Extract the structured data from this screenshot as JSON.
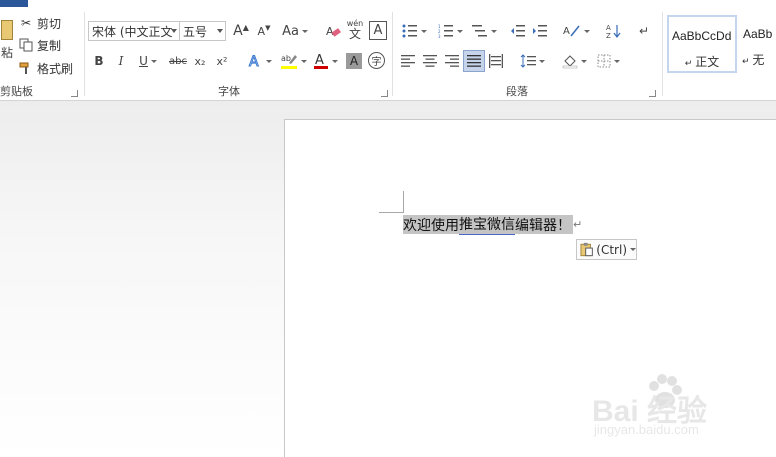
{
  "clipboard": {
    "label": "剪贴板",
    "paste_label": "粘",
    "cut_label": "剪切",
    "copy_label": "复制",
    "format_painter_label": "格式刷"
  },
  "font": {
    "label": "字体",
    "font_name": "宋体 (中文正文",
    "font_size": "五号",
    "bold": "B",
    "italic": "I",
    "underline": "U",
    "strikethrough": "abc",
    "subscript": "x₂",
    "superscript": "x²",
    "change_case": "Aa",
    "grow": "A",
    "shrink": "A",
    "phonetic": "wén",
    "phonetic_char": "文",
    "border_char": "A",
    "enclose_char": "字"
  },
  "paragraph": {
    "label": "段落"
  },
  "styles": {
    "normal_sample": "AaBbCcDd",
    "normal_name": "正文",
    "nospacing_sample": "AaBb",
    "nospacing_name": "无"
  },
  "document": {
    "text_plain": "欢迎使用",
    "text_underlined": "推宝微信",
    "text_tail": "编辑器！",
    "paragraph_mark": "↵",
    "paste_options_label": "(Ctrl)"
  },
  "watermark": {
    "text": "Bai 经验",
    "url": "jingyan.baidu.com"
  },
  "colors": {
    "accent": "#2b579a",
    "font_color_bar": "#d00000",
    "highlight_bar": "#ffff00",
    "selection": "#c4c4c4"
  }
}
